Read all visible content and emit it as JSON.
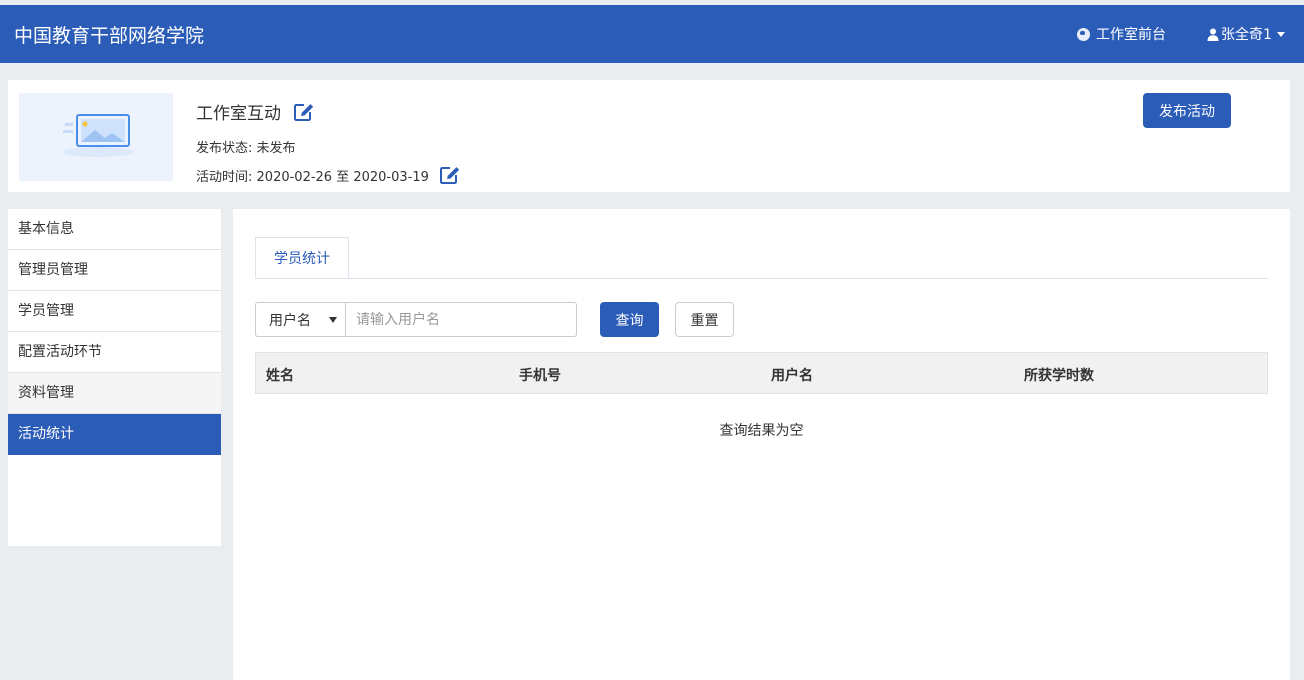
{
  "header": {
    "brand": "中国教育干部网络学院",
    "front_link": "工作室前台",
    "user": "张全奇1",
    "colors": {
      "primary": "#2b5cb8"
    }
  },
  "activity": {
    "title": "工作室互动",
    "status_label": "发布状态:",
    "status_value": "未发布",
    "time_label": "活动时间:",
    "time_value": "2020-02-26 至 2020-03-19",
    "publish_button": "发布活动"
  },
  "sidebar": {
    "items": [
      {
        "label": "基本信息"
      },
      {
        "label": "管理员管理"
      },
      {
        "label": "学员管理"
      },
      {
        "label": "配置活动环节"
      },
      {
        "label": "资料管理"
      },
      {
        "label": "活动统计"
      }
    ],
    "active": "活动统计"
  },
  "main": {
    "tab": "学员统计",
    "search": {
      "field_selected": "用户名",
      "placeholder": "请输入用户名",
      "query_button": "查询",
      "reset_button": "重置"
    },
    "table": {
      "columns": [
        "姓名",
        "手机号",
        "用户名",
        "所获学时数"
      ],
      "empty_text": "查询结果为空"
    }
  }
}
